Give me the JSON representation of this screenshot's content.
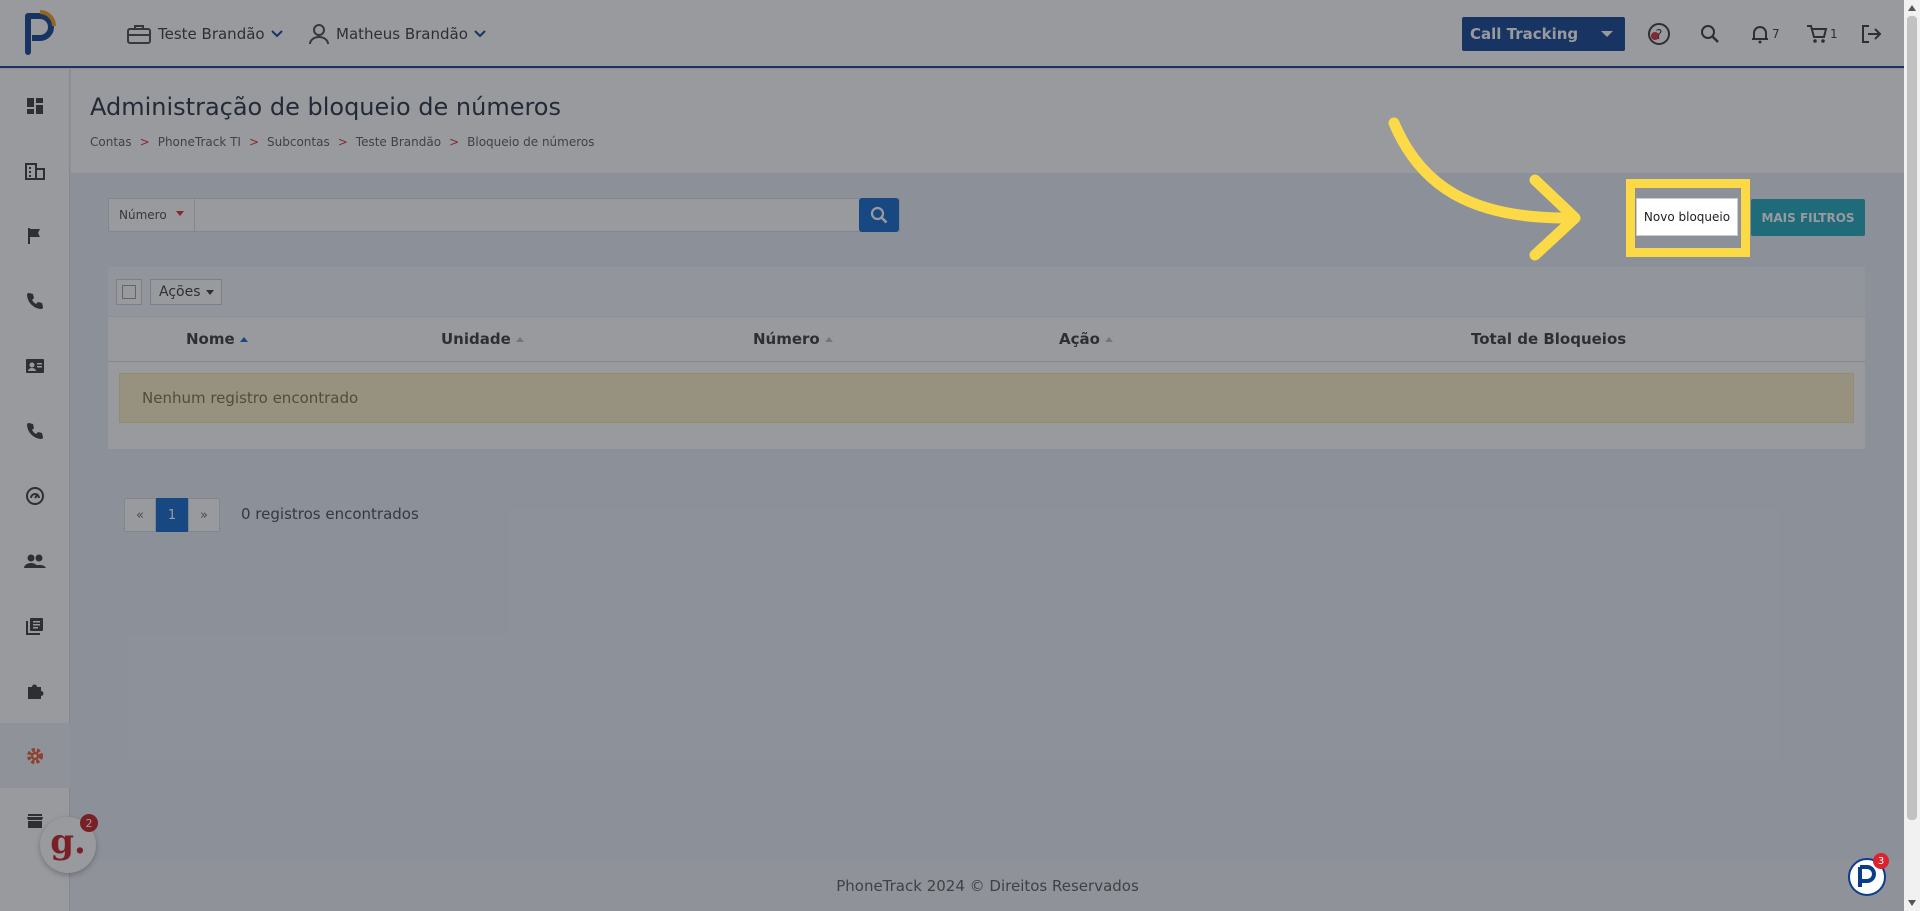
{
  "header": {
    "account_context": "Teste Brandão",
    "user_context": "Matheus Brandão",
    "product_select": "Call Tracking",
    "notifications_count": "7",
    "cart_count": "1"
  },
  "sidebar": {
    "items": [
      {
        "icon": "dashboard-icon"
      },
      {
        "icon": "building-icon"
      },
      {
        "icon": "flag-icon"
      },
      {
        "icon": "phone-icon"
      },
      {
        "icon": "contact-card-icon"
      },
      {
        "icon": "phone-call-icon"
      },
      {
        "icon": "gauge-icon"
      },
      {
        "icon": "users-icon"
      },
      {
        "icon": "library-icon"
      },
      {
        "icon": "puzzle-icon"
      },
      {
        "icon": "gear-icon",
        "active": true
      },
      {
        "icon": "store-icon"
      }
    ]
  },
  "page": {
    "title": "Administração de bloqueio de números",
    "breadcrumb": [
      "Contas",
      "PhoneTrack TI",
      "Subcontas",
      "Teste Brandão",
      "Bloqueio de números"
    ]
  },
  "search": {
    "type_label": "Número",
    "placeholder": ""
  },
  "actions": {
    "new_block": "Novo bloqueio",
    "more_filters": "MAIS FILTROS",
    "bulk_actions": "Ações"
  },
  "table": {
    "columns": [
      "Nome",
      "Unidade",
      "Número",
      "Ação",
      "Total de Bloqueios"
    ],
    "empty_message": "Nenhum registro encontrado"
  },
  "pagination": {
    "prev": "«",
    "current": "1",
    "next": "»",
    "count_text": "0 registros encontrados"
  },
  "footer": {
    "text": "PhoneTrack 2024 © Direitos Reservados"
  },
  "widgets": {
    "g_letter": "g.",
    "g_badge": "2",
    "p_badge": "3"
  },
  "colors": {
    "brand_navy": "#0b3c8c",
    "accent_red": "#d9232e",
    "primary_blue": "#0b63c9",
    "teal": "#1aa5b9",
    "highlight_yellow": "#fcd947"
  }
}
